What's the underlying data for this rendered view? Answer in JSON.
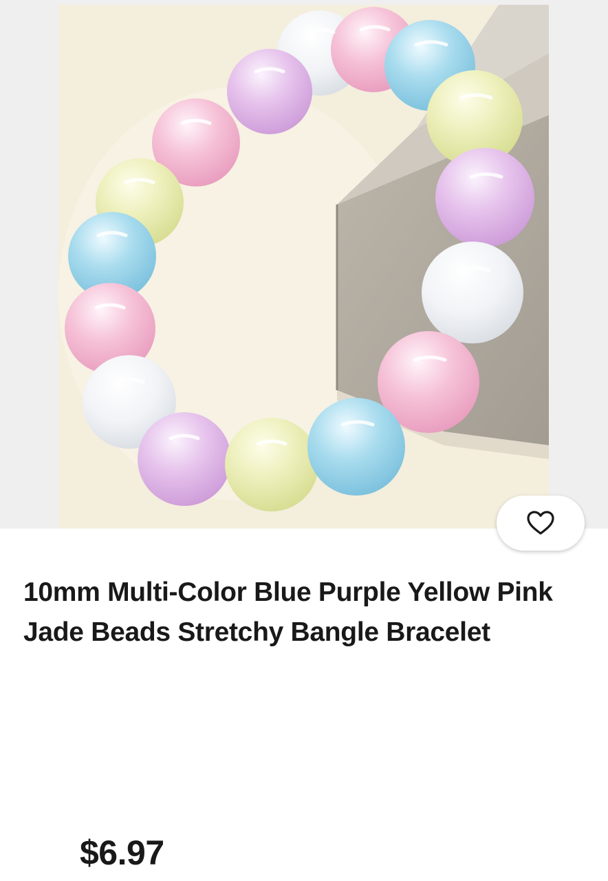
{
  "listing": {
    "title": "10mm Multi-Color Blue Purple Yellow Pink Jade Beads Stretchy Bangle Bracelet",
    "price": "$6.97"
  },
  "icons": {
    "favorite": "heart-outline-icon"
  },
  "colors": {
    "text": "#191919",
    "gallery_background": "#efefef",
    "bead_pink": "#f7bfd6",
    "bead_blue": "#a6d9ec",
    "bead_purple": "#e4bdea",
    "bead_yellow": "#eef0b8",
    "bead_white": "#f2f4f6"
  }
}
